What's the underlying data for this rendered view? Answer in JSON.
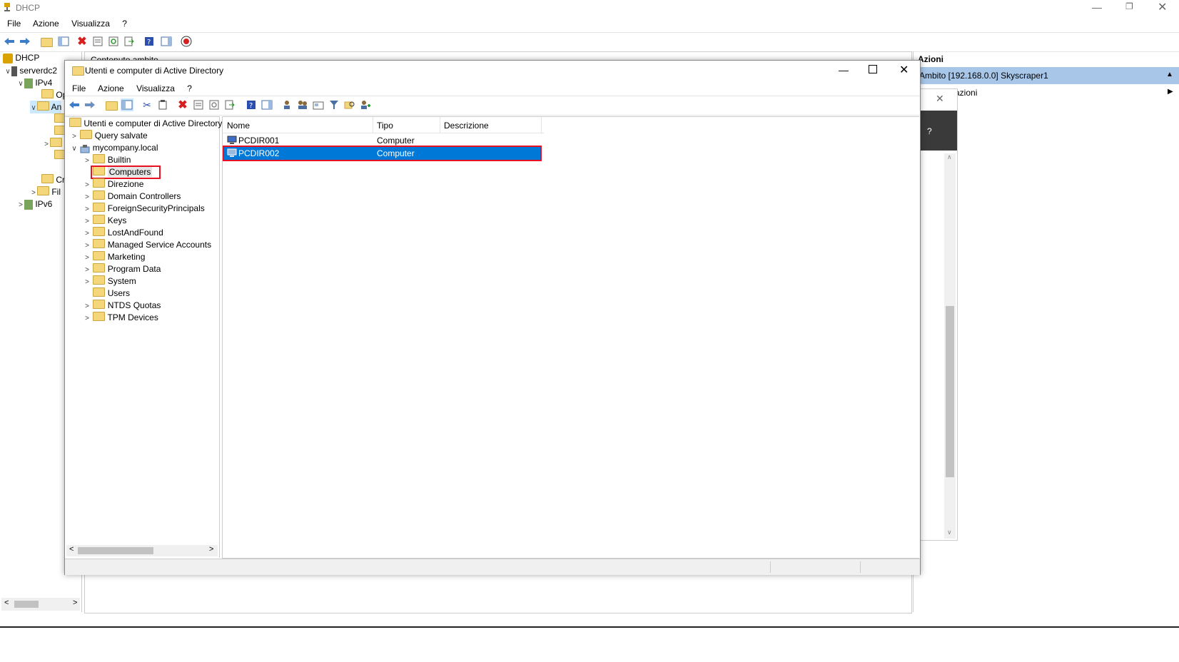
{
  "dhcp": {
    "title": "DHCP",
    "menu": [
      "File",
      "Azione",
      "Visualizza",
      "?"
    ],
    "tree": [
      "DHCP",
      "serverdc2",
      "IPv4",
      "Op",
      "An",
      "Cr",
      "Fil",
      "IPv6"
    ],
    "content_header": "Contenuto ambito",
    "actions_title": "Azioni",
    "actions_scope": "Ambito [192.168.0.0] Skyscraper1",
    "actions_more": "Altre azioni",
    "help_label": "?"
  },
  "aduc": {
    "title": "Utenti e computer di Active Directory",
    "menu": [
      "File",
      "Azione",
      "Visualizza",
      "?"
    ],
    "tree_root": "Utenti e computer di Active Directory",
    "tree_items": [
      {
        "label": "Query salvate"
      },
      {
        "label": "mycompany.local"
      },
      {
        "label": "Builtin"
      },
      {
        "label": "Computers"
      },
      {
        "label": "Direzione"
      },
      {
        "label": "Domain Controllers"
      },
      {
        "label": "ForeignSecurityPrincipals"
      },
      {
        "label": "Keys"
      },
      {
        "label": "LostAndFound"
      },
      {
        "label": "Managed Service Accounts"
      },
      {
        "label": "Marketing"
      },
      {
        "label": "Program Data"
      },
      {
        "label": "System"
      },
      {
        "label": "Users"
      },
      {
        "label": "NTDS Quotas"
      },
      {
        "label": "TPM Devices"
      }
    ],
    "columns": [
      "Nome",
      "Tipo",
      "Descrizione"
    ],
    "rows": [
      {
        "name": "PCDIR001",
        "type": "Computer",
        "desc": ""
      },
      {
        "name": "PCDIR002",
        "type": "Computer",
        "desc": ""
      }
    ]
  },
  "colors": {
    "selection": "#0078d7",
    "highlight_box": "#e81123",
    "folder": "#f5d77b"
  }
}
